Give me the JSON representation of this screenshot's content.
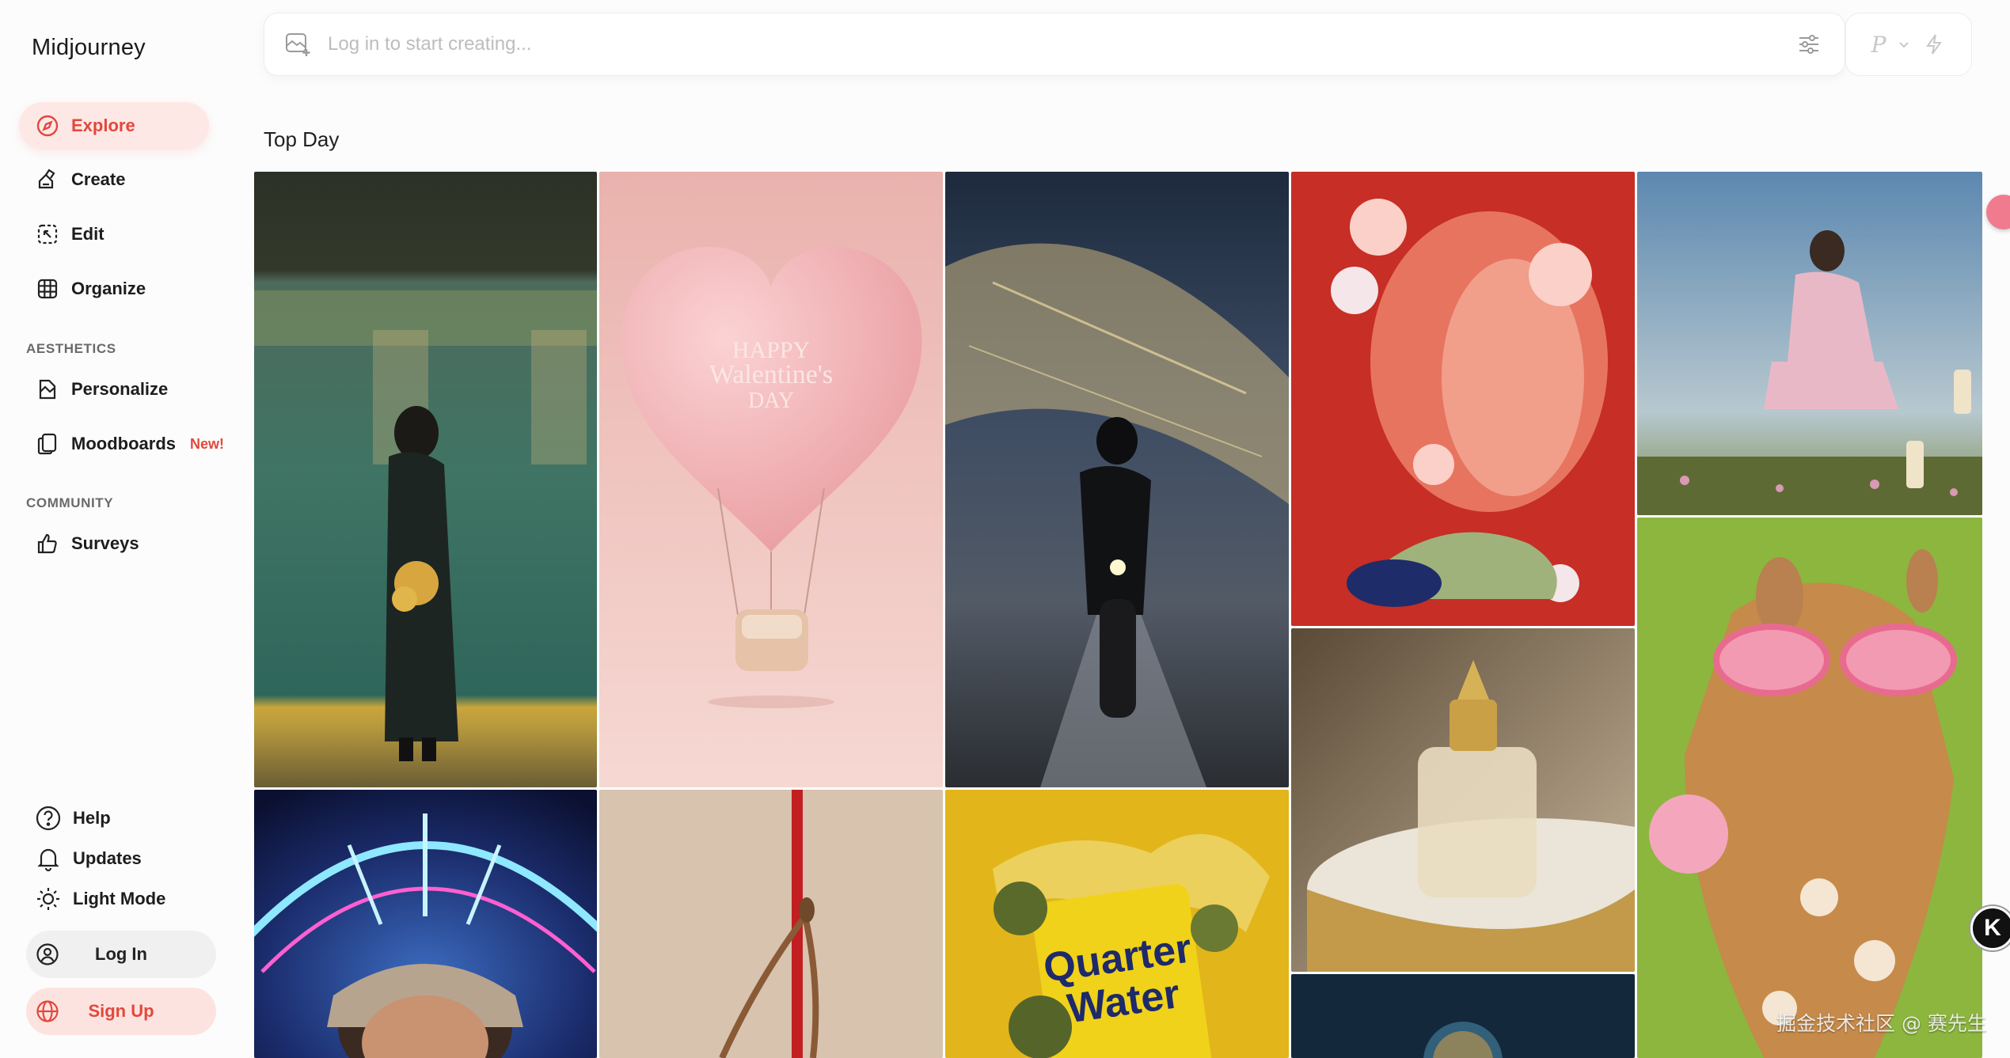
{
  "app": {
    "brand": "Midjourney"
  },
  "nav": {
    "explore": "Explore",
    "create": "Create",
    "edit": "Edit",
    "organize": "Organize"
  },
  "sections": {
    "aesthetics": "AESTHETICS",
    "community": "COMMUNITY"
  },
  "aesthetics": {
    "personalize": "Personalize",
    "moodboards": "Moodboards",
    "moodboards_badge": "New!"
  },
  "community": {
    "surveys": "Surveys"
  },
  "bottom": {
    "help": "Help",
    "updates": "Updates",
    "light_mode": "Light Mode",
    "log_in": "Log In",
    "sign_up": "Sign Up"
  },
  "search": {
    "placeholder": "Log in to start creating...",
    "mode_letter": "P"
  },
  "feed": {
    "title": "Top Day",
    "images": [
      {
        "name": "woman-subway-motion-blur",
        "alt": ""
      },
      {
        "name": "pink-heart-balloon",
        "alt": "",
        "text_lines": [
          "HAPPY",
          "Walentine's",
          "DAY"
        ]
      },
      {
        "name": "motorcycle-night-city",
        "alt": ""
      },
      {
        "name": "glass-head-flowers",
        "alt": ""
      },
      {
        "name": "levitating-man-chess",
        "alt": ""
      },
      {
        "name": "perfume-bottle",
        "alt": ""
      },
      {
        "name": "giraffe-sunglasses-bubblegum",
        "alt": ""
      },
      {
        "name": "neon-selfie",
        "alt": ""
      },
      {
        "name": "cherry-stem",
        "alt": ""
      },
      {
        "name": "quarter-water-can",
        "alt": "",
        "text_lines": [
          "Quarter",
          "Water"
        ]
      },
      {
        "name": "glass-orb-plant",
        "alt": ""
      }
    ]
  },
  "overlay": {
    "float_button_letter": "K",
    "watermark": "掘金技术社区 @ 赛先生"
  },
  "colors": {
    "accent": "#e2483c",
    "accent_bg": "#fde8e6"
  }
}
